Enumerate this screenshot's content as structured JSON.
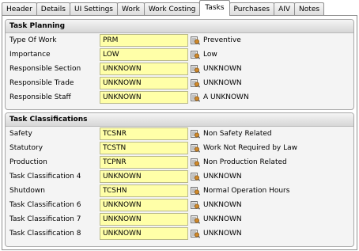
{
  "tabs": [
    {
      "label": "Header"
    },
    {
      "label": "Details"
    },
    {
      "label": "UI Settings"
    },
    {
      "label": "Work"
    },
    {
      "label": "Work Costing"
    },
    {
      "label": "Tasks",
      "active": true
    },
    {
      "label": "Purchases"
    },
    {
      "label": "AIV"
    },
    {
      "label": "Notes"
    }
  ],
  "icons": {
    "lookup": "lookup-search-icon"
  },
  "task_planning": {
    "title": "Task Planning",
    "rows": [
      {
        "label": "Type Of Work",
        "value": "PRM",
        "desc": "Preventive"
      },
      {
        "label": "Importance",
        "value": "LOW",
        "desc": "Low"
      },
      {
        "label": "Responsible Section",
        "value": "UNKNOWN",
        "desc": "UNKNOWN"
      },
      {
        "label": "Responsible Trade",
        "value": "UNKNOWN",
        "desc": "UNKNOWN"
      },
      {
        "label": "Responsible Staff",
        "value": "UNKNOWN",
        "desc": "A UNKNOWN"
      }
    ]
  },
  "task_classifications": {
    "title": "Task Classifications",
    "rows": [
      {
        "label": "Safety",
        "value": "TCSNR",
        "desc": "Non Safety Related"
      },
      {
        "label": "Statutory",
        "value": "TCSTN",
        "desc": "Work Not Required by Law"
      },
      {
        "label": "Production",
        "value": "TCPNR",
        "desc": "Non Production Related"
      },
      {
        "label": "Task Classification 4",
        "value": "UNKNOWN",
        "desc": "UNKNOWN"
      },
      {
        "label": "Shutdown",
        "value": "TCSHN",
        "desc": "Normal Operation Hours"
      },
      {
        "label": "Task Classification 6",
        "value": "UNKNOWN",
        "desc": "UNKNOWN"
      },
      {
        "label": "Task Classification 7",
        "value": "UNKNOWN",
        "desc": "UNKNOWN"
      },
      {
        "label": "Task Classification 8",
        "value": "UNKNOWN",
        "desc": "UNKNOWN"
      }
    ]
  }
}
